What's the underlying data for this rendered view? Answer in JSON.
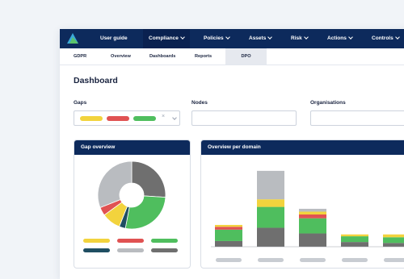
{
  "topnav": {
    "items": [
      {
        "label": "User guide",
        "dropdown": false,
        "active": false
      },
      {
        "label": "Compliance",
        "dropdown": true,
        "active": true
      },
      {
        "label": "Policies",
        "dropdown": true,
        "active": false
      },
      {
        "label": "Assets",
        "dropdown": true,
        "active": false
      },
      {
        "label": "Risk",
        "dropdown": true,
        "active": false
      },
      {
        "label": "Actions",
        "dropdown": true,
        "active": false
      },
      {
        "label": "Controls",
        "dropdown": true,
        "active": false
      }
    ]
  },
  "subnav": {
    "items": [
      {
        "label": "GDPR",
        "active": false
      },
      {
        "label": "Overview",
        "active": false
      },
      {
        "label": "Dashboards",
        "active": false
      },
      {
        "label": "Reports",
        "active": false
      },
      {
        "label": "DPO",
        "active": true
      }
    ]
  },
  "page": {
    "title": "Dashboard"
  },
  "filters": {
    "gaps": {
      "label": "Gaps",
      "clear_icon": "×",
      "toggle_icon": "chevron-down-icon"
    },
    "nodes": {
      "label": "Nodes",
      "value": ""
    },
    "organisations": {
      "label": "Organisations",
      "value": ""
    }
  },
  "colors": {
    "navy": "#0d2a5c",
    "yellow": "#f2d33d",
    "red": "#e05252",
    "green": "#4fbe5e",
    "dark_gray": "#6f6f6f",
    "light_gray": "#b9bcc0",
    "dark_teal": "#1f4e62"
  },
  "gap_overview": {
    "title": "Gap overview",
    "chart_data": {
      "type": "pie",
      "donut": true,
      "slices": [
        {
          "color": "#6f6f6f",
          "value": 26
        },
        {
          "color": "#4fbe5e",
          "value": 27
        },
        {
          "color": "#1f4e62",
          "value": 3
        },
        {
          "color": "#f2d33d",
          "value": 9
        },
        {
          "color": "#e05252",
          "value": 4
        },
        {
          "color": "#b9bcc0",
          "value": 31
        }
      ],
      "legend": [
        "#f2d33d",
        "#e05252",
        "#4fbe5e",
        "#1f4e62",
        "#b9bcc0",
        "#6f6f6f"
      ]
    }
  },
  "domain_overview": {
    "title": "Overview per domain",
    "chart_data": {
      "type": "bar",
      "stacked": true,
      "categories": [
        "",
        "",
        "",
        "",
        ""
      ],
      "series": [
        {
          "color": "#6f6f6f",
          "values": [
            6,
            20,
            14,
            5,
            4
          ]
        },
        {
          "color": "#4fbe5e",
          "values": [
            12,
            22,
            16,
            6,
            6
          ]
        },
        {
          "color": "#e05252",
          "values": [
            3,
            0,
            4,
            0,
            0
          ]
        },
        {
          "color": "#f2d33d",
          "values": [
            2,
            8,
            3,
            2,
            3
          ]
        },
        {
          "color": "#b9bcc0",
          "values": [
            0,
            30,
            3,
            0,
            0
          ]
        }
      ],
      "ylim": [
        0,
        85
      ]
    }
  }
}
